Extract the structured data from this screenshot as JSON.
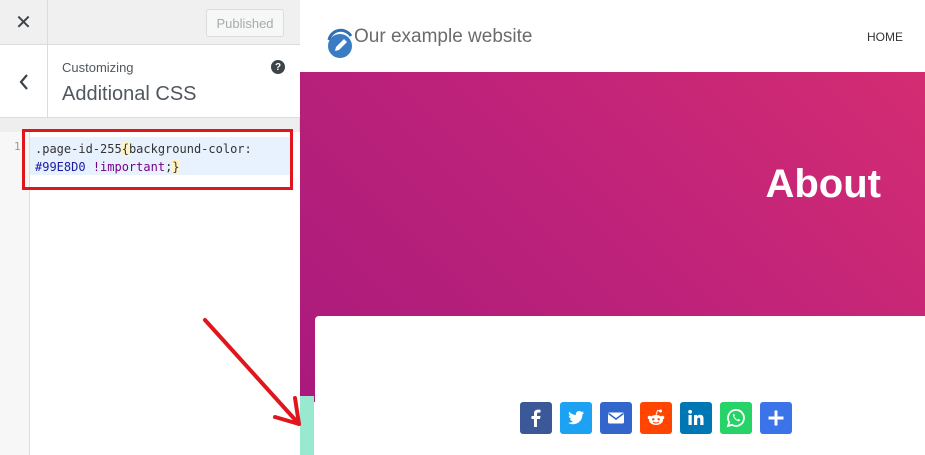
{
  "sidebar": {
    "publish_label": "Published",
    "customizing_label": "Customizing",
    "section_title": "Additional CSS",
    "help_glyph": "?",
    "close_glyph": "✕"
  },
  "editor": {
    "line_number": "1",
    "selector": ".page-id-255",
    "brace_open": "{",
    "property": "background-color:",
    "value": "#99E8D0",
    "important": "!important",
    "semicolon": ";",
    "brace_close": "}"
  },
  "preview": {
    "site_title": "Our example website",
    "nav_home": "HOME",
    "hero_title": "About"
  },
  "share_buttons": [
    {
      "name": "facebook",
      "color": "#3b5998"
    },
    {
      "name": "twitter",
      "color": "#1da1f2"
    },
    {
      "name": "email",
      "color": "#3366cc"
    },
    {
      "name": "reddit",
      "color": "#ff4500"
    },
    {
      "name": "linkedin",
      "color": "#0077b5"
    },
    {
      "name": "whatsapp",
      "color": "#25d366"
    },
    {
      "name": "share",
      "color": "#3b73e8"
    }
  ],
  "colors": {
    "highlight_box": "#e0161d",
    "page_background": "#99E8D0"
  }
}
